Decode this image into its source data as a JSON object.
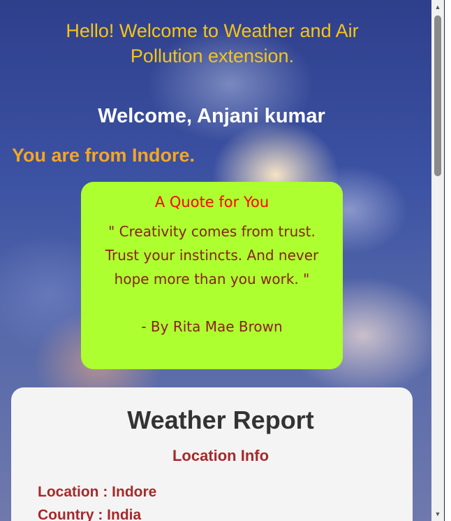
{
  "header": {
    "greeting": "Hello! Welcome to Weather and Air Pollution extension.",
    "welcome_user": "Welcome, Anjani kumar",
    "location_line": "You are from Indore."
  },
  "quote": {
    "title": "A Quote for You",
    "text": "\" Creativity comes from trust. Trust your instincts. And never hope more than you work. \"",
    "author": "- By Rita Mae Brown"
  },
  "weather_report": {
    "title": "Weather Report",
    "subtitle": "Location Info",
    "rows": [
      {
        "text": "Location : Indore"
      },
      {
        "text": "Country : India"
      }
    ]
  },
  "scrollbar": {
    "up_icon": "chevron-up-icon",
    "down_icon": "chevron-down-icon"
  },
  "colors": {
    "greeting": "#f5c518",
    "location_line": "#f5a623",
    "quote_bg": "#adff2f",
    "quote_title": "#ff0000",
    "quote_text": "#8b1e1e",
    "report_accent": "#a52a2a"
  }
}
